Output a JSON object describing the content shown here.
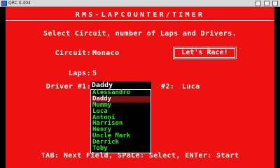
{
  "window": {
    "title": "QRC 0.404"
  },
  "header": {
    "title": "RMS-LAPCOUNTER/TIMER",
    "instruction": "Select Circuit, number of Laps and Drivers."
  },
  "form": {
    "circuit_label": "Circuit:",
    "circuit_value": "Monaco",
    "laps_label": "Laps:",
    "laps_value": "5",
    "driver1_label": "Driver #1:",
    "driver1_value": "Daddy",
    "driver2_label": "#2:",
    "driver2_value": "Luca"
  },
  "race_button": {
    "label": "Let's Race!"
  },
  "driver_dropdown": {
    "selected_index": 1,
    "options": [
      "Alessandro",
      "Daddy",
      "Mummy",
      "Luca",
      "Antoni",
      "Harrison",
      "Henry",
      "Uncle Mark",
      "Derrick",
      "Toby"
    ]
  },
  "footer": {
    "hint": "TAB: Next Field, SPaCe: Select, ENTer: Start"
  },
  "colors": {
    "background": "#ee1111",
    "text": "#ffffff",
    "list_text": "#22ee22",
    "list_selected": "#7a1010"
  }
}
